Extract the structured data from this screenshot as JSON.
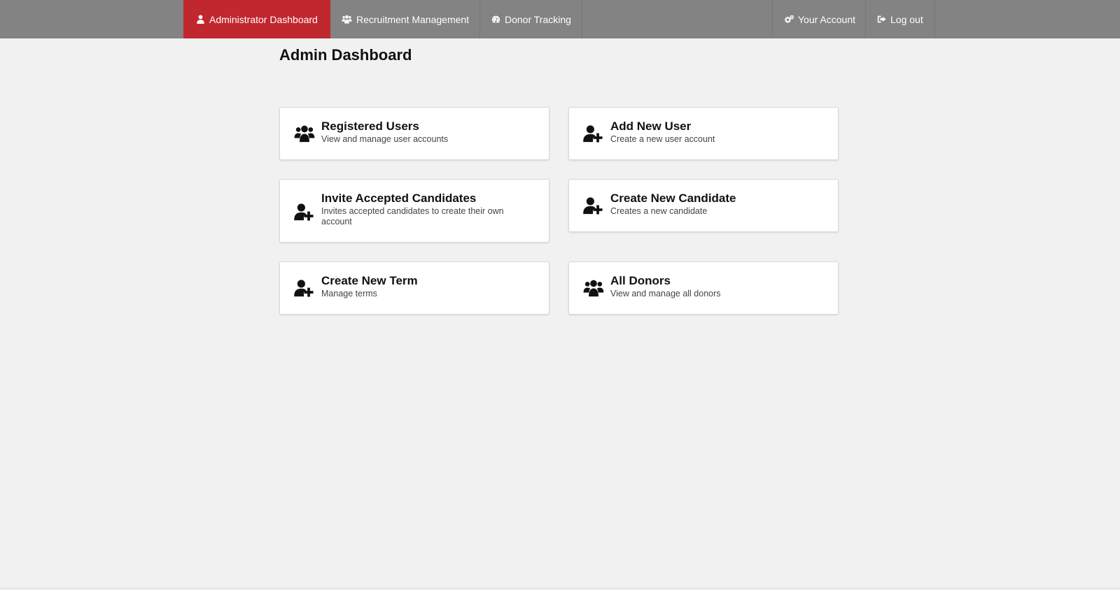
{
  "nav": {
    "items": [
      {
        "label": "Administrator Dashboard",
        "icon": "user-icon",
        "active": true
      },
      {
        "label": "Recruitment Management",
        "icon": "users-icon"
      },
      {
        "label": "Donor Tracking",
        "icon": "dashboard-icon"
      }
    ],
    "right": [
      {
        "label": "Your Account",
        "icon": "gears-icon"
      },
      {
        "label": "Log out",
        "icon": "sign-out-icon"
      }
    ]
  },
  "page": {
    "title": "Admin Dashboard"
  },
  "cards": [
    {
      "title": "Registered Users",
      "subtitle": "View and manage user accounts",
      "icon": "users-icon"
    },
    {
      "title": "Add New User",
      "subtitle": "Create a new user account",
      "icon": "user-plus-icon"
    },
    {
      "title": "Invite Accepted Candidates",
      "subtitle": "Invites accepted candidates to create their own account",
      "icon": "user-plus-icon"
    },
    {
      "title": "Create New Candidate",
      "subtitle": "Creates a new candidate",
      "icon": "user-plus-icon"
    },
    {
      "title": "Create New Term",
      "subtitle": "Manage terms",
      "icon": "user-plus-icon"
    },
    {
      "title": "All Donors",
      "subtitle": "View and manage all donors",
      "icon": "users-icon"
    }
  ],
  "colors": {
    "navbar": "#838383",
    "active_tab": "#c0272f",
    "background": "#f1f1f1"
  }
}
